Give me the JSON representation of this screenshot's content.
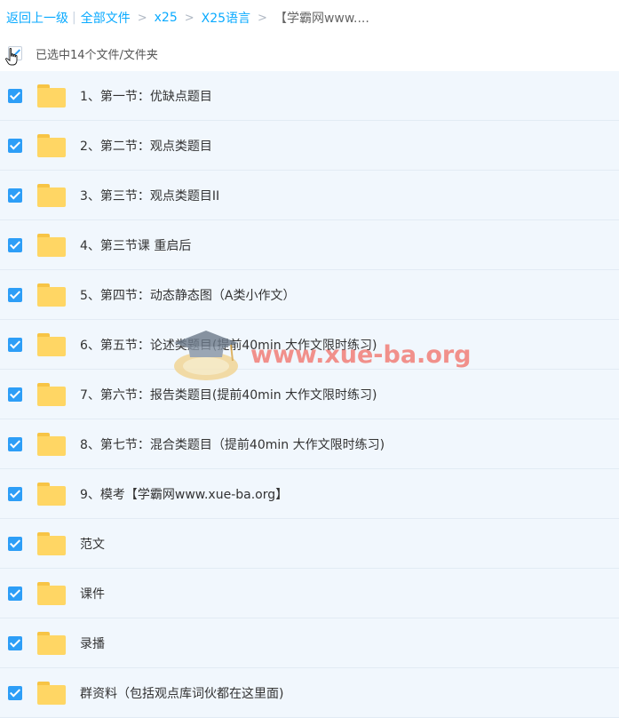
{
  "breadcrumb": {
    "back": "返回上一级",
    "all_files": "全部文件",
    "level1": "x25",
    "level2": "X25语言",
    "current": "【学霸网www...."
  },
  "selection": {
    "label": "已选中14个文件/文件夹"
  },
  "files": [
    {
      "name": "1、第一节：优缺点题目",
      "checked": true
    },
    {
      "name": "2、第二节：观点类题目",
      "checked": true
    },
    {
      "name": "3、第三节：观点类题目II",
      "checked": true
    },
    {
      "name": "4、第三节课 重启后",
      "checked": true
    },
    {
      "name": "5、第四节：动态静态图（A类小作文）",
      "checked": true
    },
    {
      "name": "6、第五节：论述类题目(提前40min 大作文限时练习)",
      "checked": true
    },
    {
      "name": "7、第六节：报告类题目(提前40min 大作文限时练习)",
      "checked": true
    },
    {
      "name": "8、第七节：混合类题目（提前40min 大作文限时练习)",
      "checked": true
    },
    {
      "name": "9、模考【学霸网www.xue-ba.org】",
      "checked": true
    },
    {
      "name": "范文",
      "checked": true
    },
    {
      "name": "课件",
      "checked": true
    },
    {
      "name": "录播",
      "checked": true
    },
    {
      "name": "群资料（包括观点库词伙都在这里面)",
      "checked": true
    }
  ],
  "watermark": {
    "text": "www.xue-ba.org"
  },
  "colors": {
    "link": "#09aaff",
    "checkbox": "#2d9ef7",
    "folder": "#ffd664",
    "row_bg": "#f1f7fd"
  }
}
